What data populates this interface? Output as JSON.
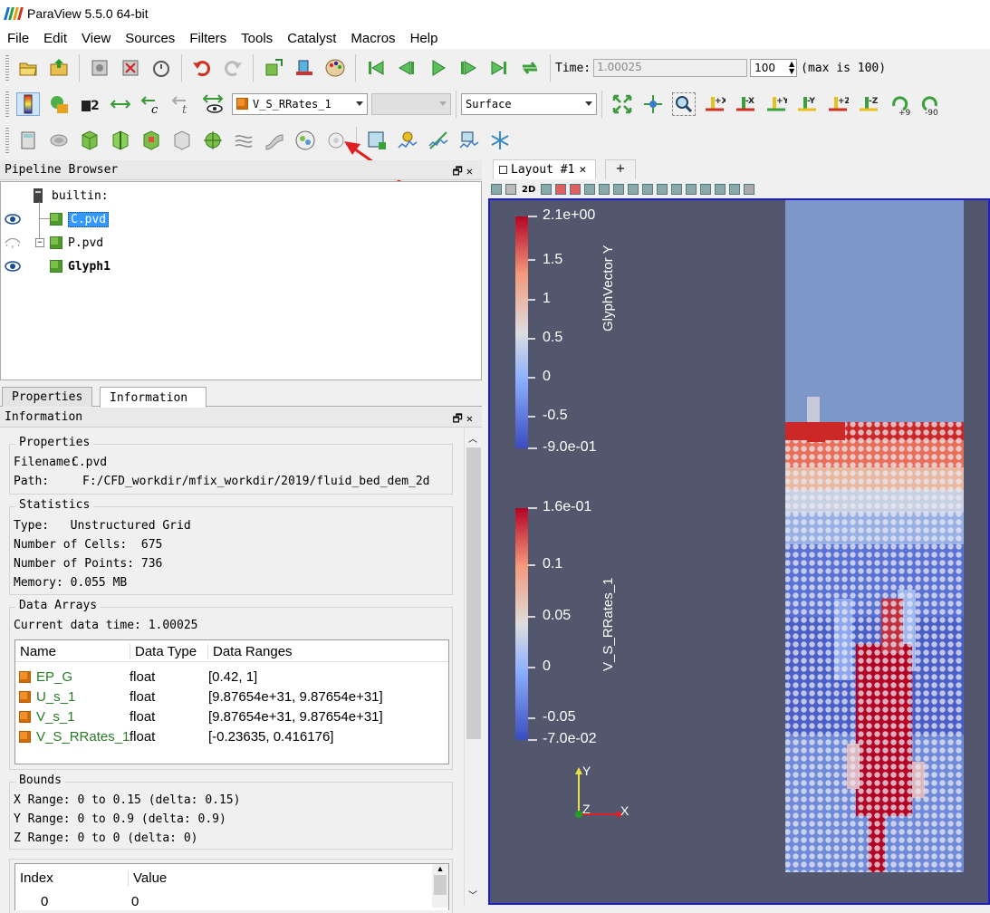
{
  "window": {
    "title": "ParaView 5.5.0 64-bit"
  },
  "menu": [
    "File",
    "Edit",
    "View",
    "Sources",
    "Filters",
    "Tools",
    "Catalyst",
    "Macros",
    "Help"
  ],
  "time": {
    "label": "Time:",
    "value": "1.00025",
    "index": "100",
    "max_label": "(max is 100)"
  },
  "toolbar2": {
    "array_combo": "V_S_RRates_1",
    "representation": "Surface"
  },
  "axis_buttons": [
    "+X",
    "-X",
    "+Y",
    "-Y",
    "+Z",
    "-Z",
    "+90",
    "-90"
  ],
  "pipeline": {
    "title": "Pipeline Browser",
    "root": "builtin:",
    "items": [
      {
        "label": "C.pvd",
        "visible": true,
        "selected": true
      },
      {
        "label": "P.pvd",
        "visible": false,
        "selected": false
      },
      {
        "label": "Glyph1",
        "visible": true,
        "selected": false
      }
    ]
  },
  "tabs": {
    "properties": "Properties",
    "information": "Information"
  },
  "info": {
    "title": "Information",
    "properties": {
      "title": "Properties",
      "filename_label": "Filename:",
      "filename": "C.pvd",
      "path_label": "Path:",
      "path": "F:/CFD_workdir/mfix_workdir/2019/fluid_bed_dem_2d"
    },
    "statistics": {
      "title": "Statistics",
      "type": "Type:   Unstructured Grid",
      "cells": "Number of Cells:  675",
      "points": "Number of Points: 736",
      "memory": "Memory: 0.055 MB"
    },
    "data_arrays": {
      "title": "Data Arrays",
      "current_time": "Current data time: 1.00025",
      "columns": [
        "Name",
        "Data Type",
        "Data Ranges"
      ],
      "rows": [
        {
          "name": "EP_G",
          "type": "float",
          "range": "[0.42, 1]"
        },
        {
          "name": "U_s_1",
          "type": "float",
          "range": "[9.87654e+31, 9.87654e+31]"
        },
        {
          "name": "V_s_1",
          "type": "float",
          "range": "[9.87654e+31, 9.87654e+31]"
        },
        {
          "name": "V_S_RRates_1",
          "type": "float",
          "range": "[-0.23635, 0.416176]"
        }
      ]
    },
    "bounds": {
      "title": "Bounds",
      "x": "X Range: 0 to 0.15 (delta: 0.15)",
      "y": "Y Range: 0 to 0.9 (delta: 0.9)",
      "z": "Z Range: 0 to 0 (delta: 0)"
    },
    "time_table": {
      "columns": [
        "Index",
        "Value"
      ],
      "rows": [
        {
          "index": "0",
          "value": "0"
        }
      ]
    }
  },
  "layout": {
    "tab": "Layout #1",
    "add": "+",
    "view_2d": "2D"
  },
  "colorbar1": {
    "title": "GlyphVector Y",
    "ticks": [
      "2.1e+00",
      "1.5",
      "1",
      "0.5",
      "0",
      "-0.5",
      "-9.0e-01"
    ]
  },
  "colorbar2": {
    "title": "V_S_RRates_1",
    "ticks": [
      "1.6e-01",
      "0.1",
      "0.05",
      "0",
      "-0.05",
      "-7.0e-02"
    ]
  },
  "axes": {
    "y": "Y",
    "z": "Z",
    "x": "X"
  },
  "colors": {
    "selection": "#3399ff",
    "viewport_bg": "#52576e",
    "viewport_border": "#1c1cd0",
    "arrow": "#e02020"
  }
}
